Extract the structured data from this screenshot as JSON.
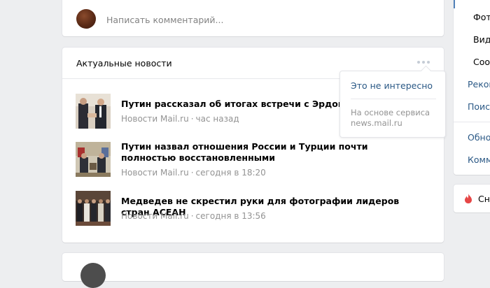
{
  "comment": {
    "placeholder": "Написать комментарий..."
  },
  "news_block": {
    "title": "Актуальные новости",
    "items": [
      {
        "title": "Путин рассказал об итогах встречи с Эрдоганом",
        "source": "Новости Mail.ru",
        "separator": "·",
        "time": "час назад"
      },
      {
        "title": "Путин назвал отношения России и Турции почти полностью восстановленными",
        "source": "Новости Mail.ru",
        "separator": "·",
        "time": "сегодня в 18:20"
      },
      {
        "title": "Медведев не скрестил руки для фотографии лидеров стран АСЕАН",
        "source": "Новости Mail.ru",
        "separator": "·",
        "time": "сегодня в 13:56"
      }
    ]
  },
  "dropdown": {
    "not_interested": "Это не интересно",
    "note": "На основе сервиса news.mail.ru"
  },
  "sidebar": {
    "items": [
      {
        "label": "Фот"
      },
      {
        "label": "Вид"
      },
      {
        "label": "Сооб"
      },
      {
        "label": "Реком"
      },
      {
        "label": "Поиск"
      },
      {
        "label": "Обно"
      },
      {
        "label": "Комм"
      }
    ],
    "share": "Сна"
  },
  "colors": {
    "link": "#2a5885",
    "muted": "#939393",
    "background": "#edeef0",
    "accent": "#5181b8",
    "fire": "#e64646"
  },
  "icons": {
    "more": "more-dots-icon",
    "fire": "fire-icon"
  }
}
